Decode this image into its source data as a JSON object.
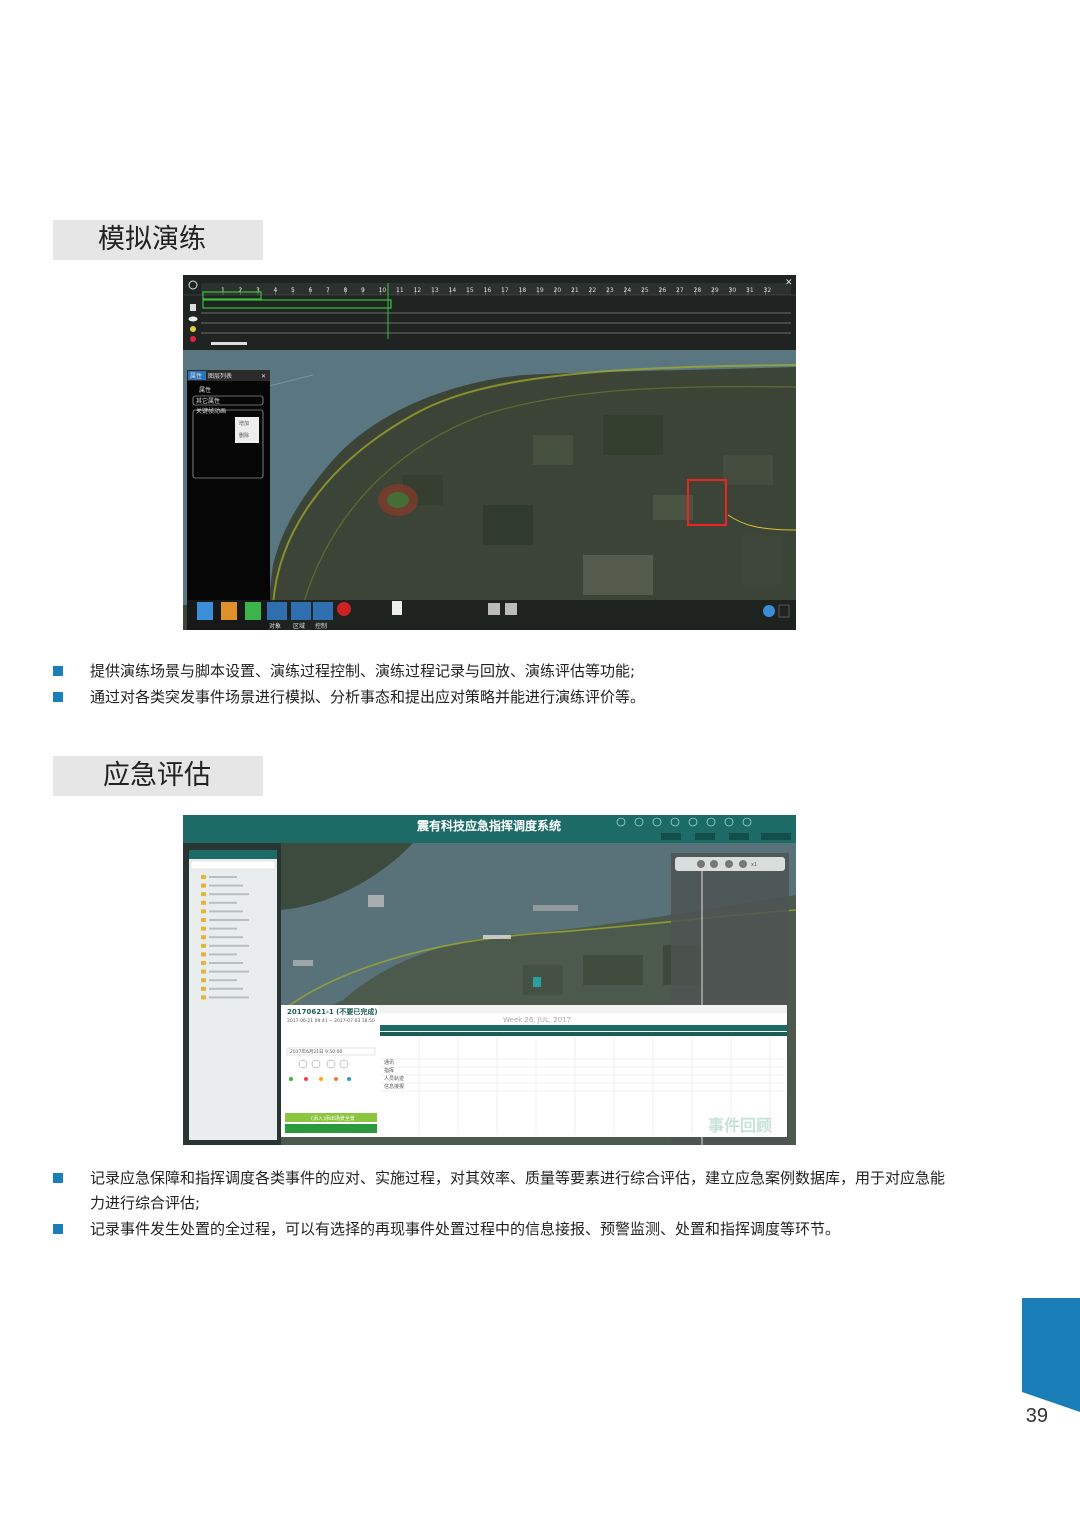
{
  "page_number": "39",
  "section1": {
    "title": "模拟演练",
    "bullets": [
      "提供演练场景与脚本设置、演练过程控制、演练过程记录与回放、演练评估等功能;",
      "通过对各类突发事件场景进行模拟、分析事态和提出应对策略并能进行演练评价等。"
    ],
    "screenshot": {
      "timeline_ticks": [
        "1",
        "2",
        "3",
        "4",
        "5",
        "6",
        "7",
        "8",
        "9",
        "10",
        "11",
        "12",
        "13",
        "14",
        "15",
        "16",
        "17",
        "18",
        "19",
        "20",
        "21",
        "22",
        "23",
        "24",
        "25",
        "26",
        "27",
        "28",
        "29",
        "30",
        "31",
        "32"
      ],
      "panel_tabs": [
        "属性",
        "图层列表"
      ],
      "panel_items": [
        "属性",
        "其它属性",
        "关键帧动画"
      ],
      "context_menu": [
        "增加",
        "删除"
      ],
      "toolbar_labels": [
        "对象",
        "区域",
        "控制"
      ]
    }
  },
  "section2": {
    "title": "应急评估",
    "bullets": [
      "记录应急保障和指挥调度各类事件的应对、实施过程，对其效率、质量等要素进行综合评估，建立应急案例数据库，用于对应急能力进行综合评估;",
      "记录事件发生处置的全过程，可以有选择的再现事件处置过程中的信息接报、预警监测、处置和指挥调度等环节。"
    ],
    "screenshot": {
      "app_title": "震有科技应急指挥调度系统",
      "event_id": "20170621-1 (不要已完成)",
      "date_range": "2017-06-21 09:41 ~ 2017-07-03 18:50",
      "week_label": "Week 26, JUL, 2017",
      "play_time": "2017年6月21日 9:50:00",
      "green_button": "(添入)添出场景全景",
      "watermark": "事件回顾",
      "track_rows": [
        "通讯",
        "指挥",
        "人员轨迹",
        "信息接报"
      ],
      "speed_label": "x1"
    }
  },
  "colors": {
    "accent_blue": "#1a7fb8",
    "title_band": "#e6e6e6",
    "teal_header": "#1d6b66"
  }
}
